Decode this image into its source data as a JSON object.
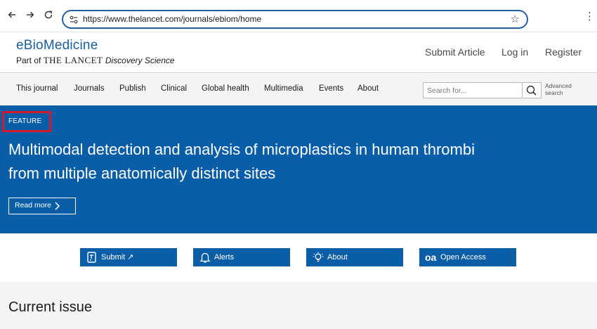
{
  "browser": {
    "url": "https://www.thelancet.com/journals/ebiom/home",
    "icons": [
      "back-arrow-icon",
      "forward-arrow-icon",
      "reload-icon",
      "site-info-icon",
      "star-icon",
      "menu-dots-icon"
    ]
  },
  "header": {
    "logo_title": "eBioMedicine",
    "logo_part_of": "Part of",
    "logo_brand": "THE LANCET",
    "logo_discovery": "Discovery Science",
    "links": [
      "Submit Article",
      "Log in",
      "Register"
    ]
  },
  "nav": {
    "items": [
      "This journal",
      "Journals",
      "Publish",
      "Clinical",
      "Global health",
      "Multimedia",
      "Events",
      "About"
    ],
    "search_placeholder": "Search for...",
    "advanced_search": "Advanced search"
  },
  "hero": {
    "label": "FEATURE",
    "title": "Multimodal detection and analysis of microplastics in human thrombi from multiple anatomically distinct sites",
    "read_more": "Read more"
  },
  "quick_links": [
    "Submit",
    "Alerts",
    "About",
    "Open Access"
  ],
  "current_issue": {
    "title": "Current issue"
  },
  "colors": {
    "brand_blue": "#0a5ea8",
    "highlight_red": "#d6182b",
    "nav_bg": "#f4f4f4"
  }
}
